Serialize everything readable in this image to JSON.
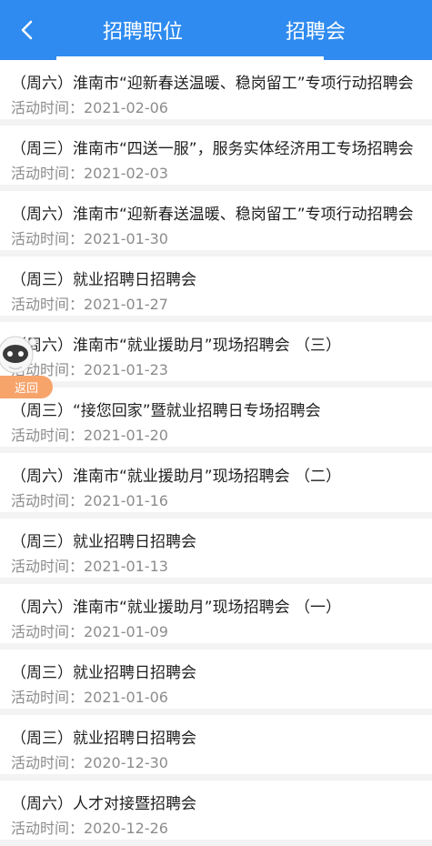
{
  "header": {
    "back_icon": "chevron-left-icon",
    "tabs": [
      {
        "label": "招聘职位",
        "active": false
      },
      {
        "label": "招聘会",
        "active": true
      }
    ],
    "background_color": "#2f8bef"
  },
  "fairs": [
    {
      "title": "（周六）淮南市“迎新春送温暖、稳岗留工”专项行动招聘会",
      "time": "活动时间：2021-02-06"
    },
    {
      "title": "（周三）淮南市“四送一服”，服务实体经济用工专场招聘会",
      "time": "活动时间：2021-02-03"
    },
    {
      "title": "（周六）淮南市“迎新春送温暖、稳岗留工”专项行动招聘会",
      "time": "活动时间：2021-01-30"
    },
    {
      "title": "（周三）就业招聘日招聘会",
      "time": "活动时间：2021-01-27"
    },
    {
      "title": "（周六）淮南市“就业援助月”现场招聘会 （三）",
      "time": "活动时间：2021-01-23"
    },
    {
      "title": "（周三）“接您回家”暨就业招聘日专场招聘会",
      "time": "活动时间：2021-01-20"
    },
    {
      "title": "（周六）淮南市“就业援助月”现场招聘会 （二）",
      "time": "活动时间：2021-01-16"
    },
    {
      "title": "（周三）就业招聘日招聘会",
      "time": "活动时间：2021-01-13"
    },
    {
      "title": "（周六）淮南市“就业援助月”现场招聘会 （一）",
      "time": "活动时间：2021-01-09"
    },
    {
      "title": "（周三）就业招聘日招聘会",
      "time": "活动时间：2021-01-06"
    },
    {
      "title": "（周三）就业招聘日招聘会",
      "time": "活动时间：2020-12-30"
    },
    {
      "title": "（周六）人才对接暨招聘会",
      "time": "活动时间：2020-12-26"
    }
  ],
  "float_widget": {
    "mascot_icon": "mascot-robot-icon",
    "return_label": "返回",
    "return_color": "#f7a46b"
  }
}
